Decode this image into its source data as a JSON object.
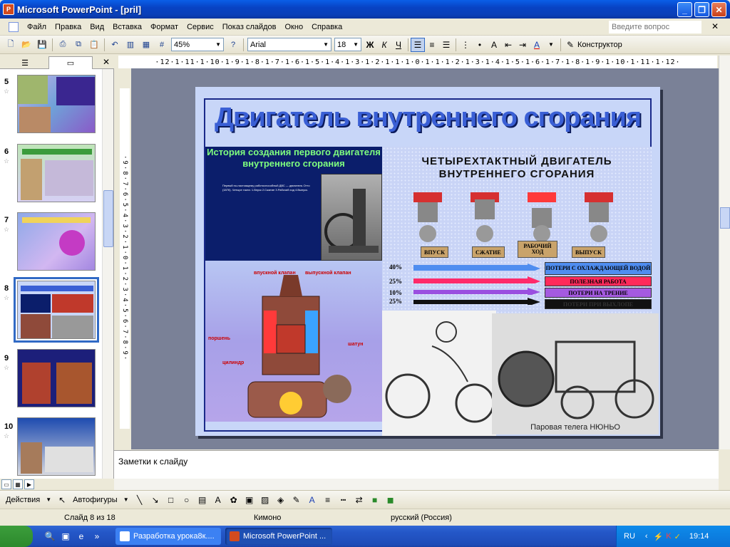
{
  "window": {
    "title": "Microsoft PowerPoint - [pril]",
    "app_icon": "ppt-icon"
  },
  "menu": {
    "items": [
      "Файл",
      "Правка",
      "Вид",
      "Вставка",
      "Формат",
      "Сервис",
      "Показ слайдов",
      "Окно",
      "Справка"
    ],
    "help_placeholder": "Введите вопрос"
  },
  "toolbar": {
    "zoom": "45%",
    "font": "Arial",
    "font_size": "18",
    "bold": "Ж",
    "italic": "К",
    "underline": "Ч",
    "designer": "Конструктор"
  },
  "outline": {
    "slides": [
      {
        "num": "5"
      },
      {
        "num": "6"
      },
      {
        "num": "7"
      },
      {
        "num": "8"
      },
      {
        "num": "9"
      },
      {
        "num": "10"
      }
    ]
  },
  "ruler": {
    "top": "·12·1·11·1·10·1·9·1·8·1·7·1·6·1·5·1·4·1·3·1·2·1·1·1·0·1·1·1·2·1·3·1·4·1·5·1·6·1·7·1·8·1·9·1·10·1·11·1·12·",
    "left": "·9·8·7·6·5·4·3·2·1·0·1·2·3·4·5·6·7·8·9·"
  },
  "slide": {
    "title": "Двигатель внутреннего сгорания",
    "history_title": "История создания первого двигателя внутреннего сгорания",
    "history_text": "Первый по-настоящему работоспособный ДВС — двигатель Отто (1876). Четыре такта: 1.Впуск 2.Сжатие 3.Рабочий ход 4.Выпуск.",
    "four_stroke_title": "ЧЕТЫРЕХТАКТНЫЙ ДВИГАТЕЛЬ ВНУТРЕННЕГО СГОРАНИЯ",
    "strokes": [
      "ВПУСК",
      "СЖАТИЕ",
      "РАБОЧИЙ ХОД",
      "ВЫПУСК"
    ],
    "losses": [
      {
        "pct": "40%",
        "label": "ПОТЕРИ С ОХЛАЖДАЮЩЕЙ ВОДОЙ",
        "color": "#4f8df0",
        "label_bg": "#4f8df0"
      },
      {
        "pct": "25%",
        "label": "ПОЛЕЗНАЯ РАБОТА",
        "color": "#ff2a6a",
        "label_bg": "#ff2a5a"
      },
      {
        "pct": "10%",
        "label": "ПОТЕРИ НА ТРЕНИЕ",
        "color": "#9a4fe0",
        "label_bg": "#a45ae0"
      },
      {
        "pct": "25%",
        "label": "ПОТЕРИ ПРИ ВЫХЛОПЕ",
        "color": "#111111",
        "label_bg": "#111111"
      }
    ],
    "engine_labels": {
      "intake": "впускной клапан",
      "exhaust": "выпускной клапан",
      "piston": "поршень",
      "cylinder": "цилиндр",
      "rod": "шатун"
    },
    "steam_caption": "Паровая телега  НЮНЬО"
  },
  "notes": {
    "placeholder": "Заметки к слайду"
  },
  "drawbar": {
    "actions": "Действия",
    "autoshapes": "Автофигуры"
  },
  "status": {
    "slide": "Слайд 8 из 18",
    "design": "Кимоно",
    "language": "русский (Россия)"
  },
  "taskbar": {
    "start": "",
    "tasks": [
      {
        "label": "Разработка урока8к...."
      },
      {
        "label": "Microsoft PowerPoint ..."
      }
    ],
    "lang": "RU",
    "clock": "19:14"
  }
}
